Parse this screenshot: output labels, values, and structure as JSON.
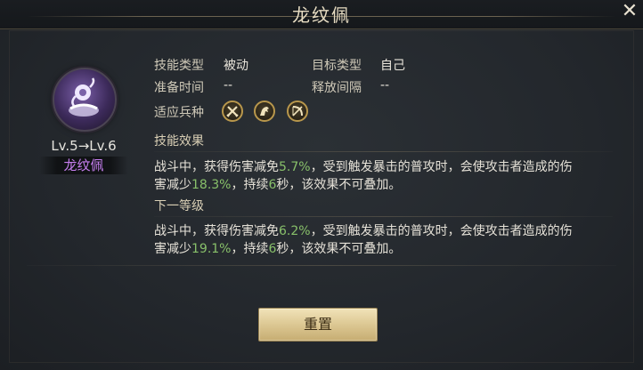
{
  "title": "龙纹佩",
  "skill": {
    "level_text": "Lv.5→Lv.6",
    "name": "龙纹佩"
  },
  "info": {
    "skill_type_label": "技能类型",
    "skill_type_value": "被动",
    "target_type_label": "目标类型",
    "target_type_value": "自己",
    "prep_time_label": "准备时间",
    "prep_time_value": "--",
    "cast_interval_label": "释放间隔",
    "cast_interval_value": "--",
    "troop_label": "适应兵种",
    "troop_icons": [
      "crossed-swords-icon",
      "horse-icon",
      "bow-icon"
    ]
  },
  "effect": {
    "title": "技能效果",
    "line1_a": "战斗中，获得伤害减免",
    "line1_v1": "5.7%",
    "line1_b": "，受到触发暴击的普攻时，会使攻击者造成的伤",
    "line2_a": "害减少",
    "line2_v2": "18.3%",
    "line2_b": "，持续",
    "line2_v3": "6",
    "line2_c": "秒，该效果不可叠加。"
  },
  "next": {
    "title": "下一等级",
    "line1_a": "战斗中，获得伤害减免",
    "line1_v1": "6.2%",
    "line1_b": "，受到触发暴击的普攻时，会使攻击者造成的伤",
    "line2_a": "害减少",
    "line2_v2": "19.1%",
    "line2_b": "，持续",
    "line2_v3": "6",
    "line2_c": "秒，该效果不可叠加。"
  },
  "reset_button": "重置",
  "colors": {
    "highlight": "#88c06a",
    "skill_name": "#c77ff0",
    "button_gold": "#d8c28c"
  }
}
